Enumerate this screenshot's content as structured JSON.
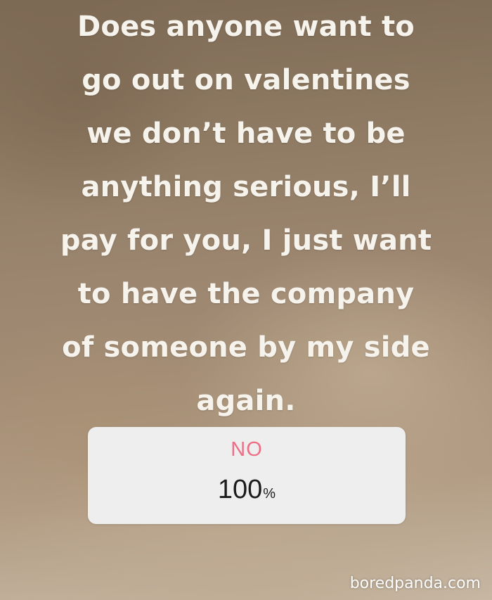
{
  "story": {
    "lines": [
      "Does anyone want to",
      "go out on valentines",
      "we don’t have to be",
      "anything serious, I’ll",
      "pay for you, I just want",
      "to have the company",
      "of someone by my side",
      "again."
    ]
  },
  "poll": {
    "option_label": "NO",
    "result_value": "100",
    "result_unit": "%"
  },
  "watermark": {
    "text": "boredpanda.com"
  },
  "colors": {
    "text": "#f6f2ec",
    "poll_background": "#eeeeee",
    "poll_option": "#ec6f86",
    "poll_result": "#1c1c1c"
  }
}
